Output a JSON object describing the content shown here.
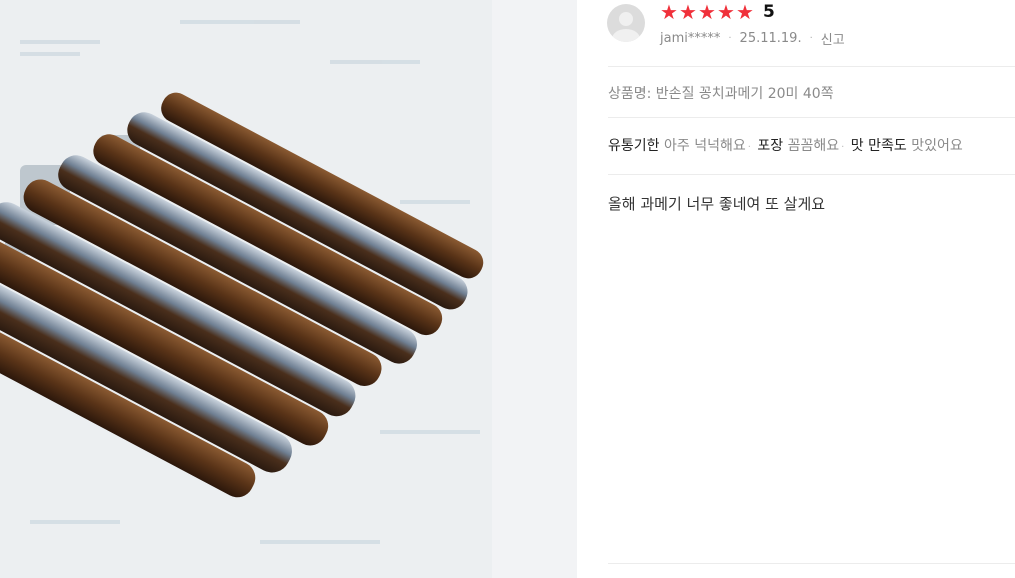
{
  "review": {
    "rating": 5,
    "score_text": "5",
    "user": "jami*****",
    "date": "25.11.19.",
    "report_label": "신고",
    "product_line": "상품명: 반손질 꽁치과메기 20미 40쪽",
    "tags": [
      {
        "key": "유통기한",
        "value": "아주 넉넉해요"
      },
      {
        "key": "포장",
        "value": "꼼꼼해요"
      },
      {
        "key": "맛 만족도",
        "value": "맛있어요"
      }
    ],
    "content": "올해 과메기 너무 좋네여 또 살게요"
  },
  "colors": {
    "star": "#f0303a",
    "muted_text": "#8a8a8a",
    "gutter": "#f2f3f5"
  },
  "icons": {
    "avatar": "default-user-avatar-icon",
    "star": "filled-star-icon"
  }
}
